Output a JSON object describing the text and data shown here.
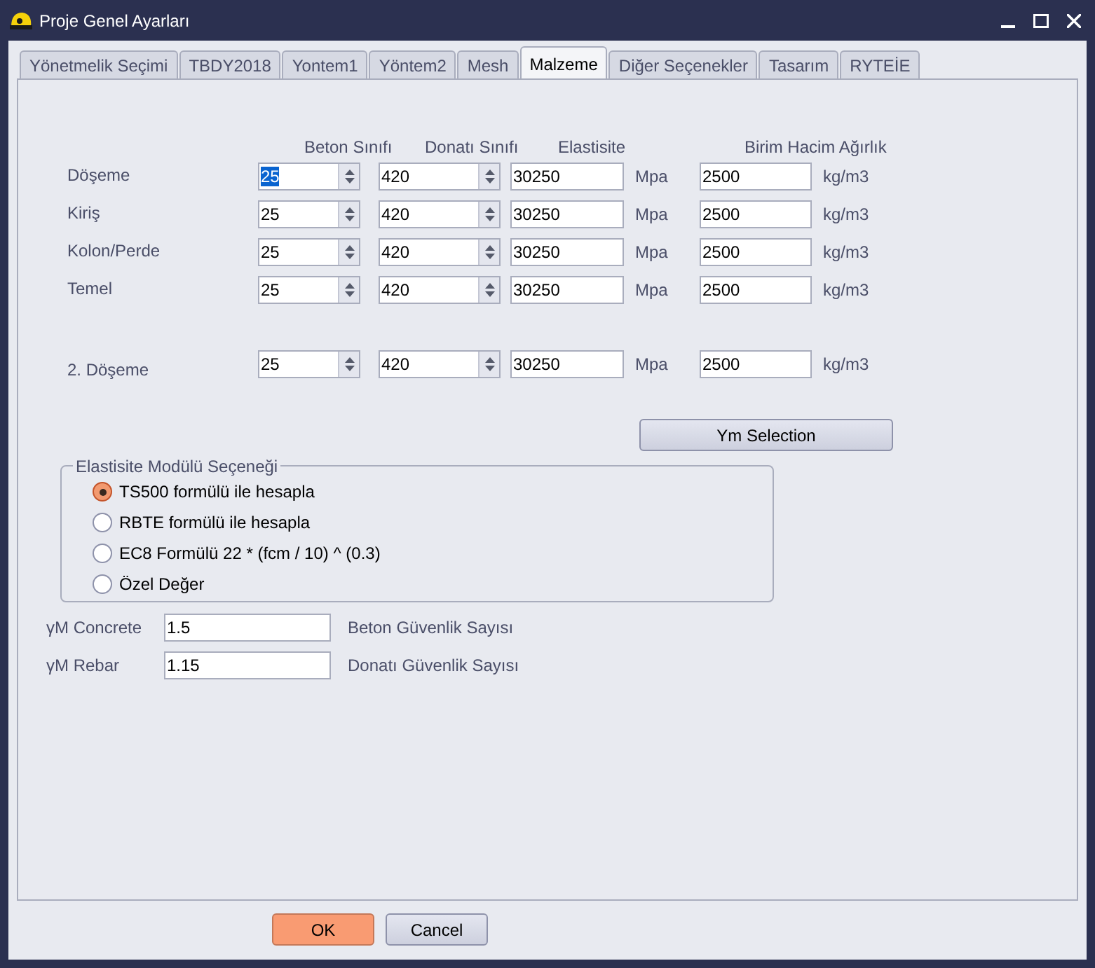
{
  "window": {
    "title": "Proje Genel Ayarları"
  },
  "tabs": [
    {
      "label": "Yönetmelik Seçimi",
      "selected": false
    },
    {
      "label": "TBDY2018",
      "selected": false
    },
    {
      "label": "Yontem1",
      "selected": false
    },
    {
      "label": "Yöntem2",
      "selected": false
    },
    {
      "label": "Mesh",
      "selected": false
    },
    {
      "label": "Malzeme",
      "selected": true
    },
    {
      "label": "Diğer Seçenekler",
      "selected": false
    },
    {
      "label": "Tasarım",
      "selected": false
    },
    {
      "label": "RYTEİE",
      "selected": false
    }
  ],
  "material_table": {
    "columns": [
      "Beton Sınıfı",
      "Donatı Sınıfı",
      "Elastisite",
      "Birim Hacim Ağırlık"
    ],
    "rows": [
      {
        "label": "Döşeme",
        "concrete": "25",
        "concrete_focused": true,
        "rebar": "420",
        "elasticity": "30250",
        "elasticity_unit": "Mpa",
        "unit_weight": "2500",
        "unit_weight_unit": "kg/m3"
      },
      {
        "label": "Kiriş",
        "concrete": "25",
        "concrete_focused": false,
        "rebar": "420",
        "elasticity": "30250",
        "elasticity_unit": "Mpa",
        "unit_weight": "2500",
        "unit_weight_unit": "kg/m3"
      },
      {
        "label": "Kolon/Perde",
        "concrete": "25",
        "concrete_focused": false,
        "rebar": "420",
        "elasticity": "30250",
        "elasticity_unit": "Mpa",
        "unit_weight": "2500",
        "unit_weight_unit": "kg/m3"
      },
      {
        "label": "Temel",
        "concrete": "25",
        "concrete_focused": false,
        "rebar": "420",
        "elasticity": "30250",
        "elasticity_unit": "Mpa",
        "unit_weight": "2500",
        "unit_weight_unit": "kg/m3"
      },
      {
        "label": "2. Döşeme",
        "concrete": "25",
        "concrete_focused": false,
        "rebar": "420",
        "elasticity": "30250",
        "elasticity_unit": "Mpa",
        "unit_weight": "2500",
        "unit_weight_unit": "kg/m3"
      }
    ]
  },
  "ym_selection_button": "Ym Selection",
  "elasticity_option_group": {
    "title": "Elastisite Modülü Seçeneği",
    "options": [
      {
        "label": "TS500 formülü ile hesapla",
        "selected": true
      },
      {
        "label": "RBTE formülü ile hesapla",
        "selected": false
      },
      {
        "label": "EC8 Formülü 22 * (fcm / 10) ^ (0.3)",
        "selected": false
      },
      {
        "label": "Özel Değer",
        "selected": false
      }
    ]
  },
  "safety_factors": [
    {
      "label": "γM Concrete",
      "value": "1.5",
      "description": "Beton Güvenlik Sayısı"
    },
    {
      "label": "γM Rebar",
      "value": "1.15",
      "description": "Donatı Güvenlik Sayısı"
    }
  ],
  "buttons": [
    {
      "label": "OK",
      "kind": "primary"
    },
    {
      "label": "Cancel",
      "kind": "secondary"
    }
  ]
}
